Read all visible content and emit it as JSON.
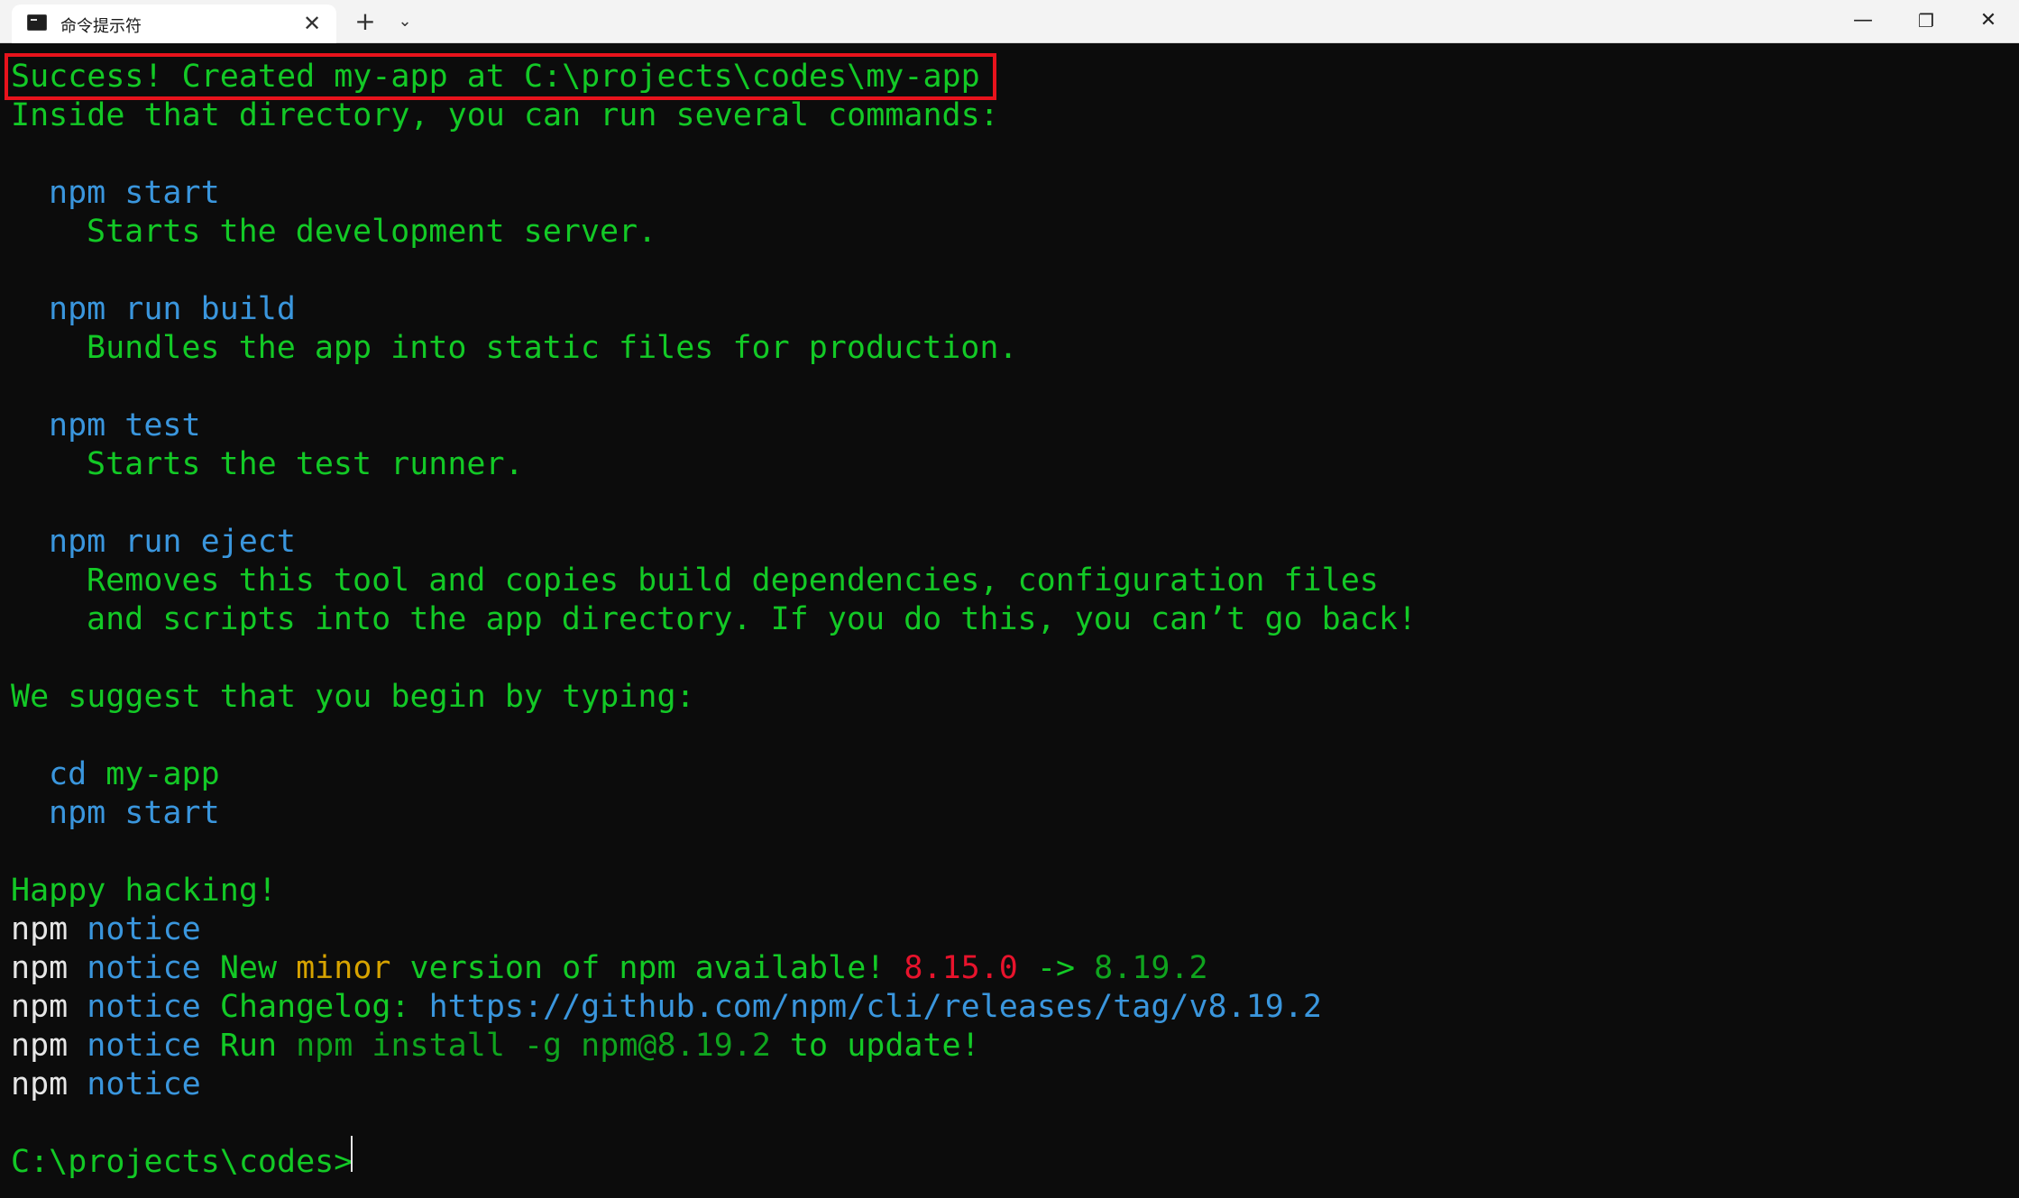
{
  "window": {
    "tab_title": "命令提示符",
    "tab_close": "✕",
    "new_tab": "+",
    "tab_dropdown": "⌄",
    "minimize": "—",
    "maximize": "❐",
    "close": "✕"
  },
  "terminal": {
    "success_line": "Success! Created my-app at C:\\projects\\codes\\my-app",
    "inside_line": "Inside that directory, you can run several commands:",
    "cmd_start": "npm start",
    "desc_start": "Starts the development server.",
    "cmd_build": "npm run build",
    "desc_build": "Bundles the app into static files for production.",
    "cmd_test": "npm test",
    "desc_test": "Starts the test runner.",
    "cmd_eject": "npm run eject",
    "desc_eject_1": "Removes this tool and copies build dependencies, configuration files",
    "desc_eject_2": "and scripts into the app directory. If you do this, you can’t go back!",
    "suggest_line": "We suggest that you begin by typing:",
    "suggest_cd": "cd",
    "suggest_cd_arg": "my-app",
    "suggest_start": "npm start",
    "happy_line": "Happy hacking!",
    "npm_prefix": "npm",
    "notice_word": "notice",
    "notice_new": "New",
    "notice_minor": "minor",
    "notice_version_text": "version of npm available!",
    "old_version": "8.15.0",
    "arrow": "->",
    "new_version": "8.19.2",
    "changelog_label": "Changelog:",
    "changelog_url": "https://github.com/npm/cli/releases/tag/v8.19.2",
    "run_label": "Run",
    "install_cmd": "npm install -g npm@8.19.2",
    "update_text": "to update!",
    "prompt": "C:\\projects\\codes>"
  },
  "colors": {
    "background": "#0c0c0c",
    "green": "#13c926",
    "blue": "#3a96dd",
    "white": "#e6e6e6",
    "yellow": "#d7a300",
    "red": "#e8132c",
    "highlight_border": "#e8131c"
  }
}
